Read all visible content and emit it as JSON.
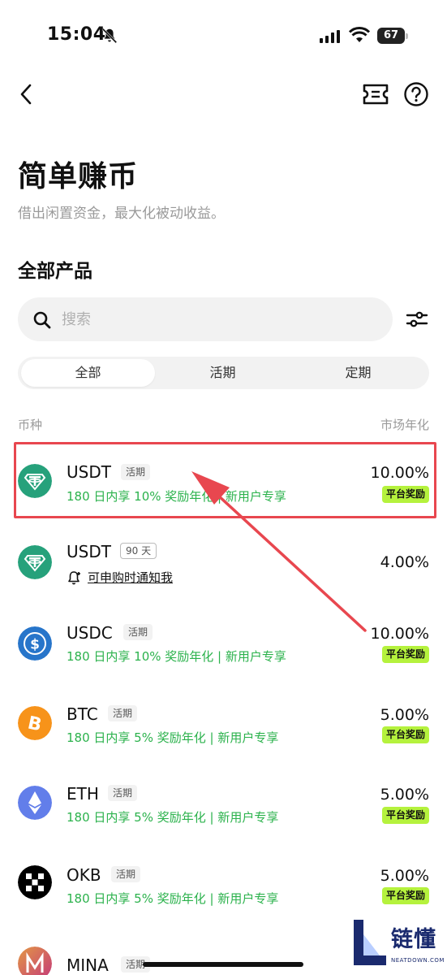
{
  "status_bar": {
    "time": "15:04",
    "battery": "67"
  },
  "header": {
    "title": "简单赚币",
    "subtitle": "借出闲置资金，最大化被动收益。"
  },
  "section": {
    "title": "全部产品"
  },
  "search": {
    "placeholder": "搜索"
  },
  "tabs": [
    {
      "label": "全部",
      "active": true
    },
    {
      "label": "活期",
      "active": false
    },
    {
      "label": "定期",
      "active": false
    }
  ],
  "columns": {
    "coin": "币种",
    "apr": "市场年化"
  },
  "products": [
    {
      "coin": "USDT",
      "tag": "活期",
      "promo": "180 日内享 10% 奖励年化 | 新用户专享",
      "rate": "10.00%",
      "badge": "平台奖励",
      "icon": "tether-icon",
      "color": "#26a17b"
    },
    {
      "coin": "USDT",
      "tag": "90 天",
      "notify": "可申购时通知我",
      "rate": "4.00%",
      "icon": "tether-icon",
      "color": "#26a17b"
    },
    {
      "coin": "USDC",
      "tag": "活期",
      "promo": "180 日内享 10% 奖励年化 | 新用户专享",
      "rate": "10.00%",
      "badge": "平台奖励",
      "icon": "usdc-icon",
      "color": "#2775ca"
    },
    {
      "coin": "BTC",
      "tag": "活期",
      "promo": "180 日内享 5% 奖励年化 | 新用户专享",
      "rate": "5.00%",
      "badge": "平台奖励",
      "icon": "bitcoin-icon",
      "color": "#f7931a"
    },
    {
      "coin": "ETH",
      "tag": "活期",
      "promo": "180 日内享 5% 奖励年化 | 新用户专享",
      "rate": "5.00%",
      "badge": "平台奖励",
      "icon": "ethereum-icon",
      "color": "#627eea"
    },
    {
      "coin": "OKB",
      "tag": "活期",
      "promo": "180 日内享 5% 奖励年化 | 新用户专享",
      "rate": "5.00%",
      "badge": "平台奖励",
      "icon": "okb-icon",
      "color": "#000000"
    },
    {
      "coin": "MINA",
      "tag": "活期",
      "icon": "mina-icon",
      "color": "#e39844"
    }
  ],
  "watermark": {
    "brand": "链懂",
    "sub": "NEATDOWN.COM"
  },
  "colors": {
    "green": "#2bb24c",
    "badge": "#b5f23d",
    "highlight": "#e8474f"
  }
}
